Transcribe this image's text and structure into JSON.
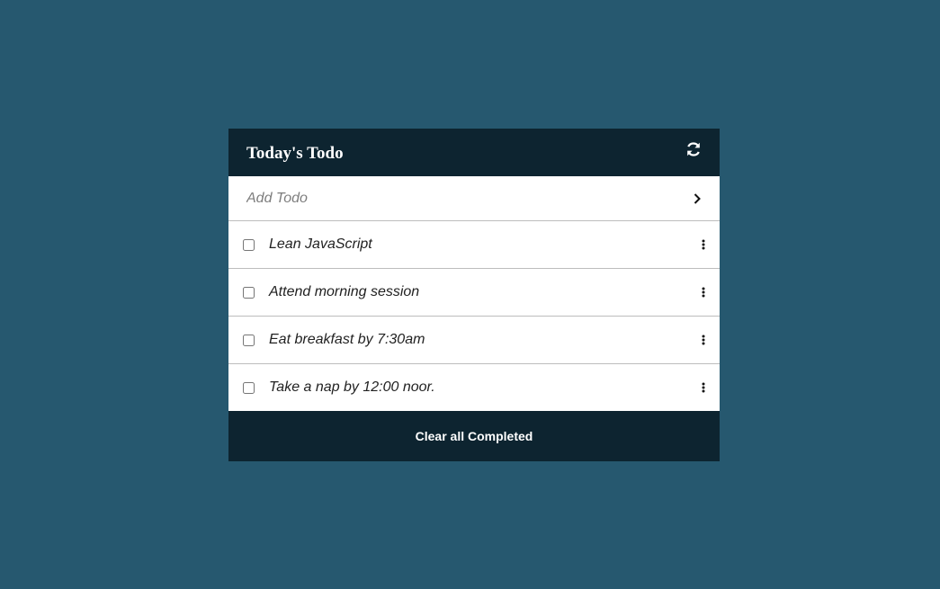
{
  "header": {
    "title": "Today's Todo",
    "refresh_icon": "refresh-icon"
  },
  "add": {
    "placeholder": "Add Todo",
    "value": "",
    "submit_icon": "chevron-right-icon"
  },
  "todos": [
    {
      "text": "Lean JavaScript",
      "checked": false
    },
    {
      "text": "Attend morning session",
      "checked": false
    },
    {
      "text": "Eat breakfast by 7:30am",
      "checked": false
    },
    {
      "text": "Take a nap by 12:00 noor.",
      "checked": false
    }
  ],
  "footer": {
    "clear_label": "Clear all Completed"
  },
  "colors": {
    "background": "#26586f",
    "header": "#0d2430",
    "card": "#ffffff"
  }
}
